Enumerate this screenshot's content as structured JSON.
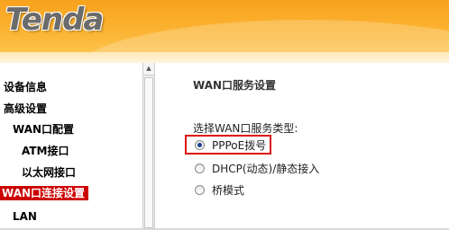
{
  "header": {
    "brand": "Tenda",
    "colors": {
      "top": "#f7a21e",
      "bottom": "#fdc958"
    }
  },
  "sidebar": {
    "items": [
      {
        "label": "设备信息",
        "level": 0,
        "active": false
      },
      {
        "label": "高级设置",
        "level": 0,
        "active": false
      },
      {
        "label": "WAN口配置",
        "level": 1,
        "active": false
      },
      {
        "label": "ATM接口",
        "level": 2,
        "active": false
      },
      {
        "label": "以太网接口",
        "level": 2,
        "active": false
      },
      {
        "label": "WAN口连接设置",
        "level": 1,
        "active": true
      },
      {
        "label": "LAN",
        "level": 1,
        "active": false
      }
    ],
    "active_color": "#cc0000"
  },
  "main": {
    "title": "WAN口服务设置",
    "service_type_label": "选择WAN口服务类型:",
    "options": [
      {
        "label": "PPPoE拨号",
        "checked": true
      },
      {
        "label": "DHCP(动态)/静态接入",
        "checked": false
      },
      {
        "label": "桥模式",
        "checked": false
      }
    ],
    "highlight_color": "#dd1111"
  }
}
